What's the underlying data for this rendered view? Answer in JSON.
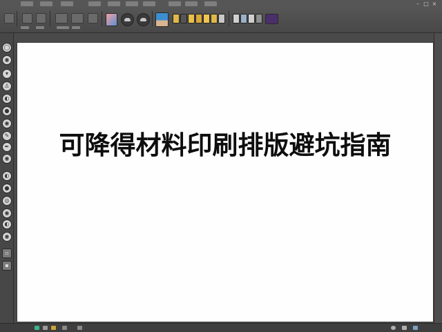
{
  "document": {
    "headline": "可降得材料印刷排版避坑指南"
  },
  "top_bar": {
    "tools": [
      "move-tool",
      "crop-tool",
      "brush-tool",
      "transform-tool",
      "layer-tool"
    ],
    "swatches": [
      "#e07a5f",
      "#5fa8d3"
    ]
  },
  "left_toolbar": {
    "tools": [
      "selection",
      "eye",
      "fill",
      "stamp",
      "erase",
      "drop",
      "eye",
      "brush",
      "pen",
      "path",
      "paint",
      "drop",
      "stamp",
      "hand",
      "zoom",
      "circle",
      "circle"
    ]
  },
  "status_bar": {
    "left_icons": [
      "green",
      "gray",
      "yellow"
    ],
    "right_icons": [
      "gear",
      "close",
      "grid"
    ]
  },
  "colors": {
    "chrome": "#4a4a4a",
    "canvas": "#fefefe",
    "headline": "#0e0e0e"
  }
}
